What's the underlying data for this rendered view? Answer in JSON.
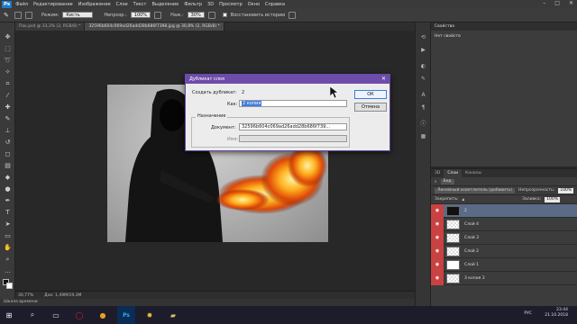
{
  "app": {
    "logo": "Ps",
    "menu": [
      "Файл",
      "Редактирование",
      "Изображение",
      "Слои",
      "Текст",
      "Выделение",
      "Фильтр",
      "3D",
      "Просмотр",
      "Окно",
      "Справка"
    ],
    "window_controls": [
      "–",
      "□",
      "✕"
    ]
  },
  "options": {
    "mode_label": "Режим:",
    "mode_value": "Кисть",
    "opacity_label": "Непрозр.:",
    "opacity_value": "100%",
    "pressure_label": "Наж.:",
    "pressure_value": "30%",
    "restore_label": "Восстановить историю"
  },
  "tabs": [
    {
      "label": "Пак.psd @ 33,3% (2, RGB/8) *",
      "active": false
    },
    {
      "label": "32596b604c069ad26add28b686f7398.jpg @ 30,8% (2, RGB/8) *",
      "active": true
    }
  ],
  "status": {
    "zoom": "30,77%",
    "doc": "Док: 1,49M/19,3M"
  },
  "timeline": "Шкала времени",
  "properties": {
    "header": "Свойства",
    "subtitle": "Нет свойств"
  },
  "layers_panel": {
    "tabs": [
      "3D",
      "Слои",
      "Каналы"
    ],
    "active_tab": "Слои",
    "filter_label": "Вид",
    "blend_mode": "Линейный осветлитель (добавить)",
    "opacity_label": "Непрозрачность:",
    "opacity_value": "100%",
    "lock_label": "Закрепить:",
    "fill_label": "Заливка:",
    "fill_value": "100%",
    "layers": [
      {
        "name": "2",
        "selected": true
      },
      {
        "name": "Слой 4",
        "selected": false
      },
      {
        "name": "Слой 3",
        "selected": false
      },
      {
        "name": "Слой 2",
        "selected": false
      },
      {
        "name": "Слой 1",
        "selected": false
      },
      {
        "name": "3 копия 3",
        "selected": false
      }
    ]
  },
  "dialog": {
    "title": "Дубликат слоя",
    "create_label": "Создать дубликат:",
    "create_value": "2",
    "as_label": "Как:",
    "as_value": "2 копия",
    "dest_label": "Назначение",
    "doc_label": "Документ:",
    "doc_value": "32596b604c069ad26add28b686f739...",
    "name_label": "Имя:",
    "ok": "ОК",
    "cancel": "Отмена",
    "close": "✕"
  },
  "taskbar": {
    "lang": "РУС",
    "time": "23:44",
    "date": "21.10.2018"
  },
  "colors": {
    "dialog_title": "#6e4ca9",
    "layer_eye": "#c94141",
    "selection": "#3b7de0"
  }
}
